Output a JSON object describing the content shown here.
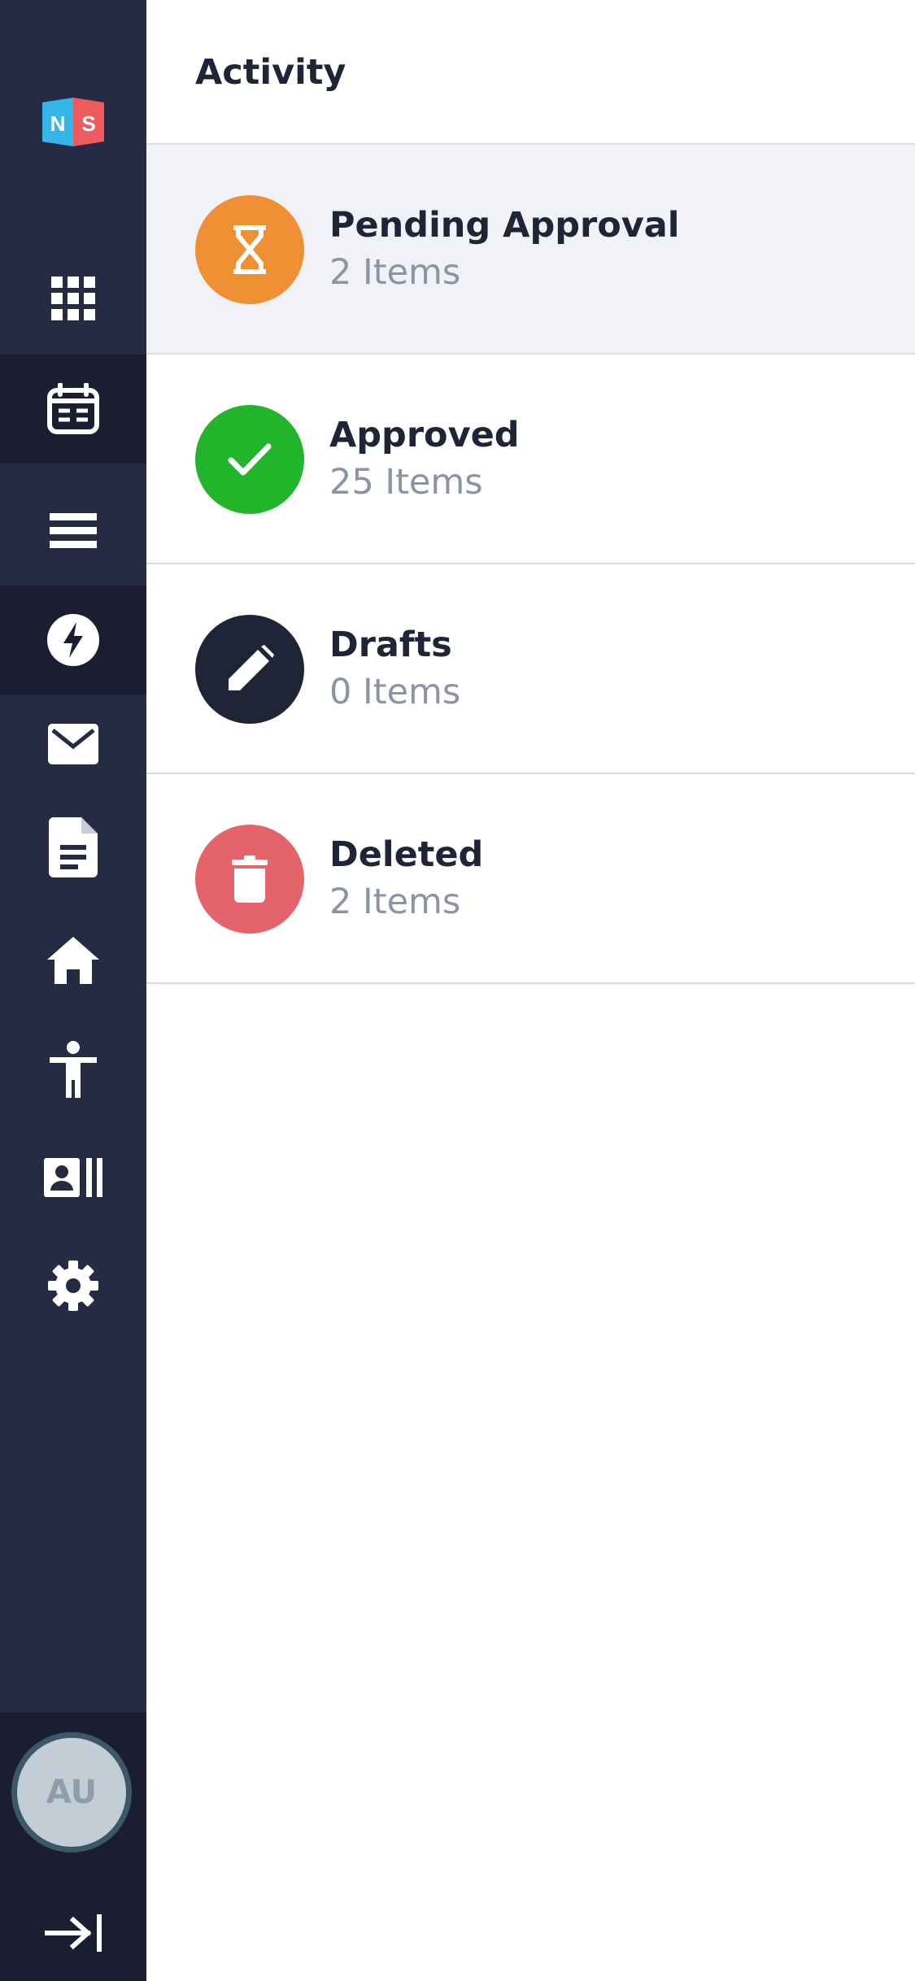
{
  "app": {
    "logo_text": "NS"
  },
  "sidebar": {
    "items": [
      {
        "name": "apps",
        "icon": "grid-icon"
      },
      {
        "name": "calendar",
        "icon": "calendar-icon"
      },
      {
        "name": "list",
        "icon": "menu-icon"
      },
      {
        "name": "activity",
        "icon": "lightning-icon"
      },
      {
        "name": "mail",
        "icon": "envelope-icon"
      },
      {
        "name": "documents",
        "icon": "document-icon"
      },
      {
        "name": "home",
        "icon": "home-icon"
      },
      {
        "name": "accessibility",
        "icon": "person-icon"
      },
      {
        "name": "contacts",
        "icon": "contact-card-icon"
      },
      {
        "name": "settings",
        "icon": "gear-icon"
      }
    ],
    "avatar_initials": "AU",
    "collapse_icon": "arrow-to-right-icon"
  },
  "header": {
    "title": "Activity"
  },
  "activity_list": [
    {
      "title": "Pending Approval",
      "count": "2 Items",
      "color": "#ef9035",
      "icon": "hourglass-icon"
    },
    {
      "title": "Approved",
      "count": "25 Items",
      "color": "#22b42a",
      "icon": "check-icon"
    },
    {
      "title": "Drafts",
      "count": "0 Items",
      "color": "#1f2437",
      "icon": "pencil-icon"
    },
    {
      "title": "Deleted",
      "count": "2 Items",
      "color": "#e5636a",
      "icon": "trash-icon"
    }
  ],
  "colors": {
    "sidebar_bg": "#262b44",
    "sidebar_active_bg": "#1b1e31",
    "highlight_row_bg": "#f0f2f7"
  }
}
